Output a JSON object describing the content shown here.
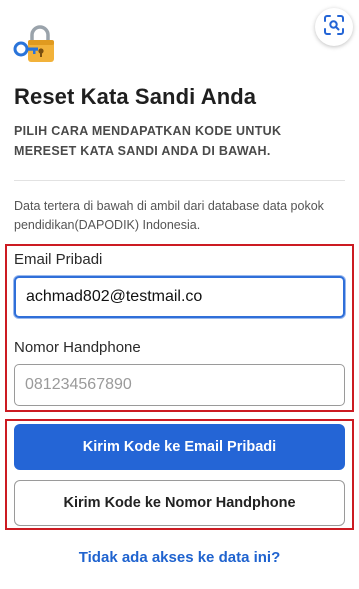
{
  "header": {
    "title": "Reset Kata Sandi Anda",
    "subtitle": "PILIH CARA MENDAPATKAN KODE UNTUK MERESET KATA SANDI ANDA DI BAWAH.",
    "info": "Data tertera di bawah di ambil dari database data pokok pendidikan(DAPODIK) Indonesia."
  },
  "form": {
    "email_label": "Email Pribadi",
    "email_value": "achmad802@testmail.co",
    "phone_label": "Nomor Handphone",
    "phone_placeholder": "081234567890"
  },
  "actions": {
    "send_email_label": "Kirim Kode ke Email Pribadi",
    "send_phone_label": "Kirim Kode ke Nomor Handphone",
    "no_access_link": "Tidak ada akses ke data ini?"
  },
  "icons": {
    "lock": "lock-key-icon",
    "scan": "scan-icon"
  },
  "colors": {
    "primary": "#2465d6",
    "link": "#1f63cf",
    "highlight_border": "#cc1b22"
  }
}
